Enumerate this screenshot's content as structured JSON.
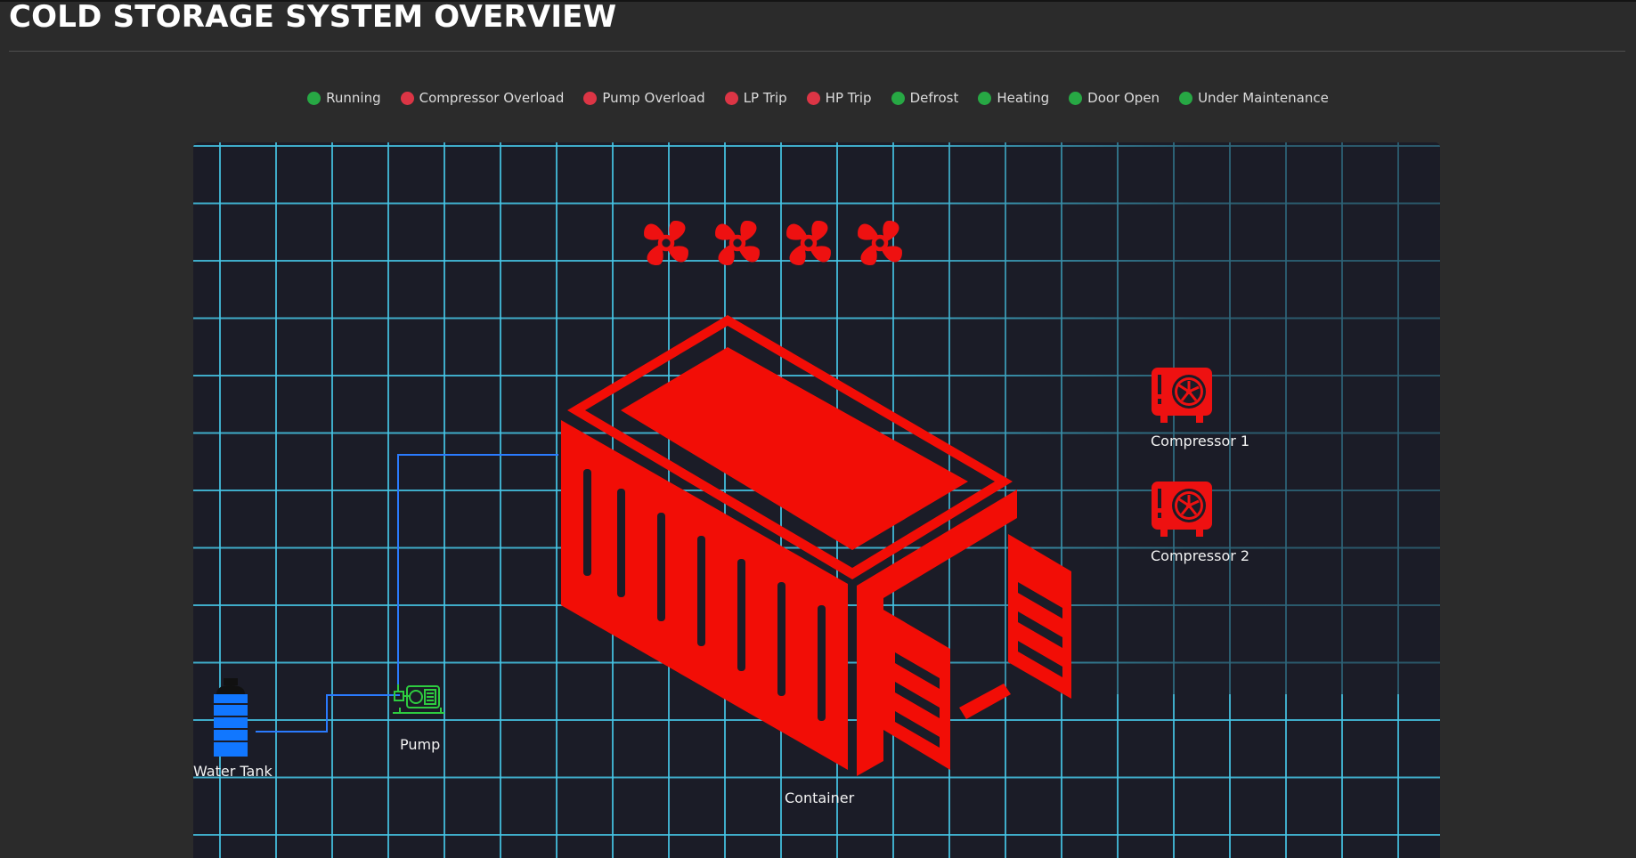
{
  "header": {
    "title": "COLD STORAGE SYSTEM OVERVIEW"
  },
  "legend": [
    {
      "label": "Running",
      "color": "#27a844"
    },
    {
      "label": "Compressor Overload",
      "color": "#dc3545"
    },
    {
      "label": "Pump Overload",
      "color": "#dc3545"
    },
    {
      "label": "LP Trip",
      "color": "#dc3545"
    },
    {
      "label": "HP Trip",
      "color": "#dc3545"
    },
    {
      "label": "Defrost",
      "color": "#27a844"
    },
    {
      "label": "Heating",
      "color": "#27a844"
    },
    {
      "label": "Door Open",
      "color": "#27a844"
    },
    {
      "label": "Under Maintenance",
      "color": "#27a844"
    }
  ],
  "diagram": {
    "fans": [
      {
        "icon": "fan-icon",
        "status_color": "#ee1111"
      },
      {
        "icon": "fan-icon",
        "status_color": "#ee1111"
      },
      {
        "icon": "fan-icon",
        "status_color": "#ee1111"
      },
      {
        "icon": "fan-icon",
        "status_color": "#ee1111"
      }
    ],
    "container": {
      "label": "Container",
      "icon": "container-icon",
      "status_color": "#f20d06"
    },
    "compressors": [
      {
        "label": "Compressor 1",
        "icon": "compressor-icon",
        "status_color": "#ee1111"
      },
      {
        "label": "Compressor 2",
        "icon": "compressor-icon",
        "status_color": "#ee1111"
      }
    ],
    "pump": {
      "label": "Pump",
      "icon": "pump-icon",
      "status_color": "#2ecc40"
    },
    "water_tank": {
      "label": "Water Tank",
      "icon": "water-tank-icon",
      "status_color": "#1177ff"
    },
    "pipe_color": "#2a7bff",
    "grid_color": "#45c6e6"
  }
}
